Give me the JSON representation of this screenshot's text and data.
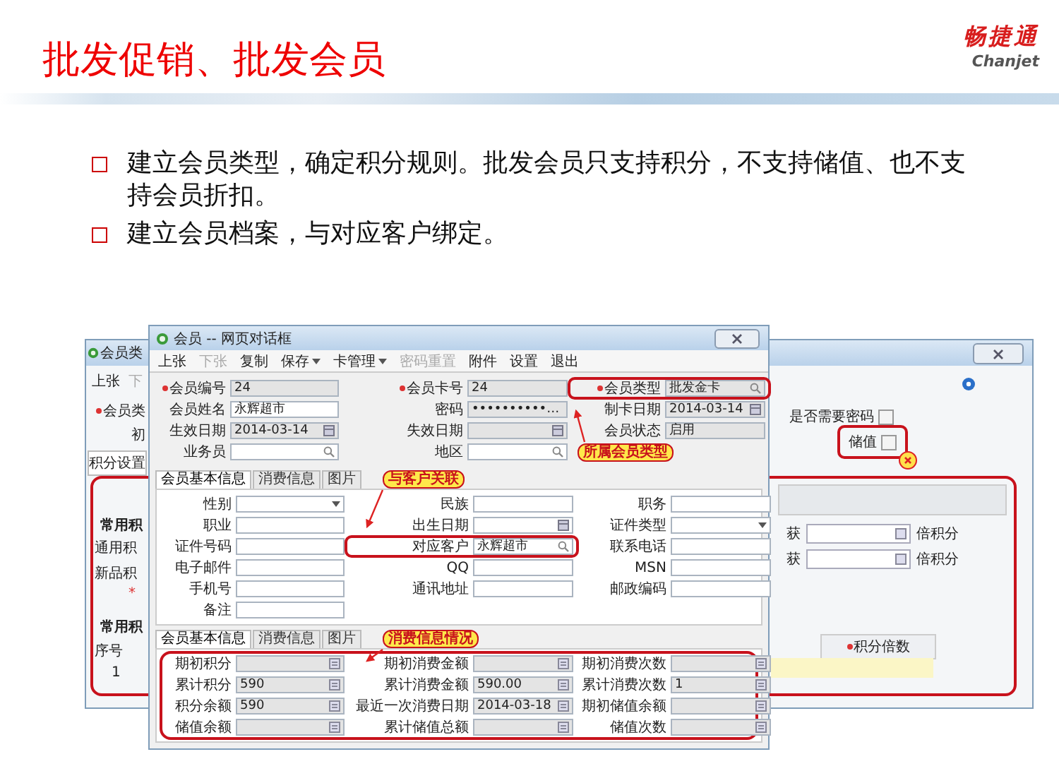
{
  "slide": {
    "title": "批发促销、批发会员",
    "logo": {
      "brand": "畅捷通",
      "sub": "Chanjet"
    },
    "bullets": [
      "建立会员类型，确定积分规则。批发会员只支持积分，不支持储值、也不支持会员折扣。",
      "建立会员档案，与对应客户绑定。"
    ]
  },
  "back_window": {
    "title": "会员类",
    "toolbar": [
      {
        "label": "上张",
        "disabled": false
      },
      {
        "label": "下",
        "disabled": true
      }
    ],
    "type_label": "会员类",
    "field_label": "初",
    "tab": "积分设置",
    "section_1": "常用积",
    "rows": [
      "通用积",
      "新品积"
    ],
    "star": "*",
    "section_2": "常用积",
    "table_header": "序号",
    "table_row": "1",
    "checkboxes": [
      {
        "label": "是否需要密码",
        "checked": false,
        "highlight": false
      },
      {
        "label": "储值",
        "checked": false,
        "highlight": true
      }
    ],
    "rate_rows": [
      {
        "label": "获",
        "unit": "倍积分"
      },
      {
        "label": "获",
        "unit": "倍积分"
      }
    ],
    "rate_header": "积分倍数"
  },
  "dialog": {
    "title": "会员 -- 网页对话框",
    "toolbar": [
      {
        "label": "上张",
        "disabled": false,
        "dropdown": false
      },
      {
        "label": "下张",
        "disabled": true,
        "dropdown": false
      },
      {
        "label": "复制",
        "disabled": false,
        "dropdown": false
      },
      {
        "label": "保存",
        "disabled": false,
        "dropdown": true
      },
      {
        "label": "卡管理",
        "disabled": false,
        "dropdown": true
      },
      {
        "label": "密码重置",
        "disabled": true,
        "dropdown": false
      },
      {
        "label": "附件",
        "disabled": false,
        "dropdown": false
      },
      {
        "label": "设置",
        "disabled": false,
        "dropdown": false
      },
      {
        "label": "退出",
        "disabled": false,
        "dropdown": false
      }
    ],
    "header_rows": [
      [
        {
          "label": "会员编号",
          "required": true,
          "value": "24",
          "kind": "text",
          "readonly": true,
          "highlight": false
        },
        {
          "label": "会员卡号",
          "required": true,
          "value": "24",
          "kind": "text",
          "readonly": true,
          "highlight": false
        },
        {
          "label": "会员类型",
          "required": true,
          "value": "批发金卡",
          "kind": "search",
          "readonly": true,
          "highlight": true
        }
      ],
      [
        {
          "label": "会员姓名",
          "required": false,
          "value": "永辉超市",
          "kind": "text",
          "readonly": false,
          "highlight": false
        },
        {
          "label": "密码",
          "required": false,
          "value": "••••••••••…",
          "kind": "text",
          "readonly": true,
          "highlight": false
        },
        {
          "label": "制卡日期",
          "required": false,
          "value": "2014-03-14",
          "kind": "date",
          "readonly": true,
          "highlight": false
        }
      ],
      [
        {
          "label": "生效日期",
          "required": false,
          "value": "2014-03-14",
          "kind": "date",
          "readonly": true,
          "highlight": false
        },
        {
          "label": "失效日期",
          "required": false,
          "kind": "date",
          "readonly": true,
          "highlight": false
        },
        {
          "label": "会员状态",
          "required": false,
          "value": "启用",
          "kind": "text",
          "readonly": true,
          "highlight": false
        }
      ],
      [
        {
          "label": "业务员",
          "required": false,
          "kind": "search",
          "readonly": false,
          "highlight": false
        },
        {
          "label": "地区",
          "required": false,
          "kind": "search",
          "readonly": false,
          "highlight": false
        }
      ]
    ],
    "tabs_1": [
      {
        "label": "会员基本信息",
        "selected": true
      },
      {
        "label": "消费信息",
        "selected": false
      },
      {
        "label": "图片",
        "selected": false
      }
    ],
    "basic_rows": [
      [
        {
          "label": "性别",
          "required": false,
          "kind": "select",
          "readonly": false,
          "highlight": false
        },
        {
          "label": "民族",
          "required": false,
          "kind": "text",
          "readonly": false,
          "highlight": false
        },
        {
          "label": "职务",
          "required": false,
          "kind": "text",
          "readonly": false,
          "highlight": false
        }
      ],
      [
        {
          "label": "职业",
          "required": false,
          "kind": "text",
          "readonly": false,
          "highlight": false
        },
        {
          "label": "出生日期",
          "required": false,
          "kind": "date",
          "readonly": false,
          "highlight": false
        },
        {
          "label": "证件类型",
          "required": false,
          "kind": "select",
          "readonly": false,
          "highlight": false
        }
      ],
      [
        {
          "label": "证件号码",
          "required": false,
          "kind": "text",
          "readonly": false,
          "highlight": false
        },
        {
          "label": "对应客户",
          "required": false,
          "value": "永辉超市",
          "kind": "search",
          "readonly": false,
          "highlight": true
        },
        {
          "label": "联系电话",
          "required": false,
          "kind": "text",
          "readonly": false,
          "highlight": false
        }
      ],
      [
        {
          "label": "电子邮件",
          "required": false,
          "kind": "text",
          "readonly": false,
          "highlight": false
        },
        {
          "label": "QQ",
          "required": false,
          "kind": "text",
          "readonly": false,
          "highlight": false
        },
        {
          "label": "MSN",
          "required": false,
          "kind": "text",
          "readonly": false,
          "highlight": false
        }
      ],
      [
        {
          "label": "手机号",
          "required": false,
          "kind": "text",
          "readonly": false,
          "highlight": false
        },
        {
          "label": "通讯地址",
          "required": false,
          "kind": "text",
          "readonly": false,
          "highlight": false
        },
        {
          "label": "邮政编码",
          "required": false,
          "kind": "text",
          "readonly": false,
          "highlight": false
        }
      ],
      [
        {
          "label": "备注",
          "required": false,
          "kind": "text",
          "readonly": false,
          "highlight": false
        }
      ]
    ],
    "tabs_2": [
      {
        "label": "会员基本信息",
        "selected": true
      },
      {
        "label": "消费信息",
        "selected": false
      },
      {
        "label": "图片",
        "selected": false
      }
    ],
    "consumption_highlight": true,
    "consumption_rows": [
      [
        {
          "label": "期初积分",
          "required": false,
          "kind": "calc",
          "readonly": true,
          "highlight": false
        },
        {
          "label": "期初消费金额",
          "required": false,
          "kind": "calc",
          "readonly": true,
          "highlight": false
        },
        {
          "label": "期初消费次数",
          "required": false,
          "kind": "calc",
          "readonly": true,
          "highlight": false
        }
      ],
      [
        {
          "label": "累计积分",
          "required": false,
          "value": "590",
          "kind": "calc",
          "readonly": true,
          "highlight": false
        },
        {
          "label": "累计消费金额",
          "required": false,
          "value": "590.00",
          "kind": "calc",
          "readonly": true,
          "highlight": false
        },
        {
          "label": "累计消费次数",
          "required": false,
          "value": "1",
          "kind": "calc",
          "readonly": true,
          "highlight": false
        }
      ],
      [
        {
          "label": "积分余额",
          "required": false,
          "value": "590",
          "kind": "calc",
          "readonly": true,
          "highlight": false
        },
        {
          "label": "最近一次消费日期",
          "required": false,
          "value": "2014-03-18",
          "kind": "calc",
          "readonly": true,
          "highlight": false
        },
        {
          "label": "期初储值余额",
          "required": false,
          "kind": "calc",
          "readonly": true,
          "highlight": false
        }
      ],
      [
        {
          "label": "储值余额",
          "required": false,
          "kind": "calc",
          "readonly": true,
          "highlight": false
        },
        {
          "label": "累计储值总额",
          "required": false,
          "kind": "calc",
          "readonly": true,
          "highlight": false
        },
        {
          "label": "储值次数",
          "required": false,
          "kind": "calc",
          "readonly": true,
          "highlight": false
        }
      ]
    ]
  },
  "callouts": [
    "所属会员类型",
    "与客户关联",
    "消费信息情况"
  ]
}
